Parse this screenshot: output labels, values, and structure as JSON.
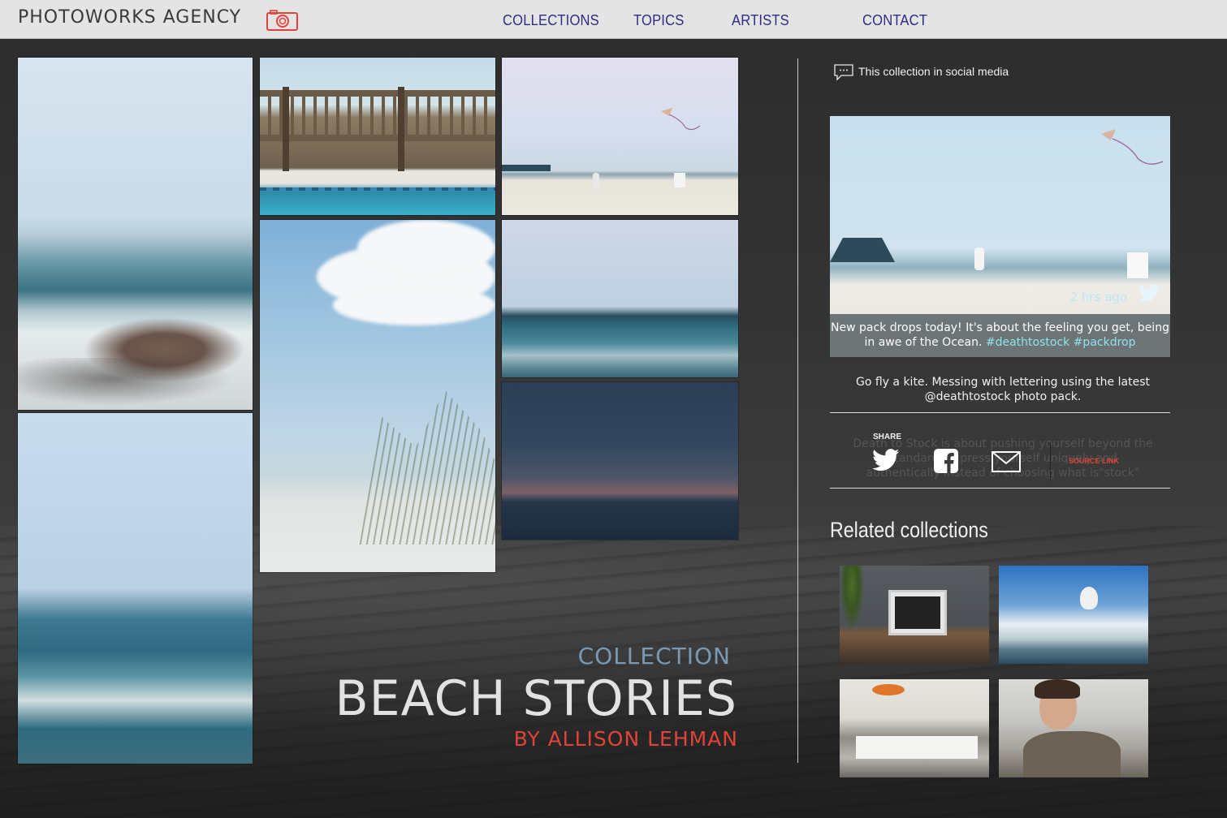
{
  "header": {
    "brand": "PHOTOWORKS AGENCY",
    "nav": [
      "COLLECTIONS",
      "TOPICS",
      "ARTISTS",
      "CONTACT"
    ]
  },
  "collection": {
    "label": "COLLECTION",
    "title": "BEACH STORIES",
    "author": "BY ALLISON LEHMAN"
  },
  "social": {
    "heading": "This collection in social media",
    "tweet": {
      "time": "2 hrs ago",
      "text": "New pack drops today! It's about the feeling you get, being in awe of the Ocean.",
      "hashtags": "#deathtostock #packdrop"
    },
    "post_text": "Go fly a kite. Messing with lettering using the latest @deathtostock photo pack.",
    "quote_text": "Death to Stock is about pushing yourself beyond the standard. Express yourself uniquely and authentically instead of choosing what is\"stock\"",
    "share_label": "SHARE",
    "source_link": "SOURCE LINK"
  },
  "related": {
    "title": "Related collections"
  },
  "colors": {
    "nav": "#2c2d84",
    "accent_red": "#e0433a",
    "collection_label": "#7a9ab3",
    "hashtag": "#8fe3ee"
  },
  "icons": [
    "camera-icon",
    "speech-bubble-icon",
    "twitter-icon",
    "facebook-icon",
    "mail-icon"
  ]
}
